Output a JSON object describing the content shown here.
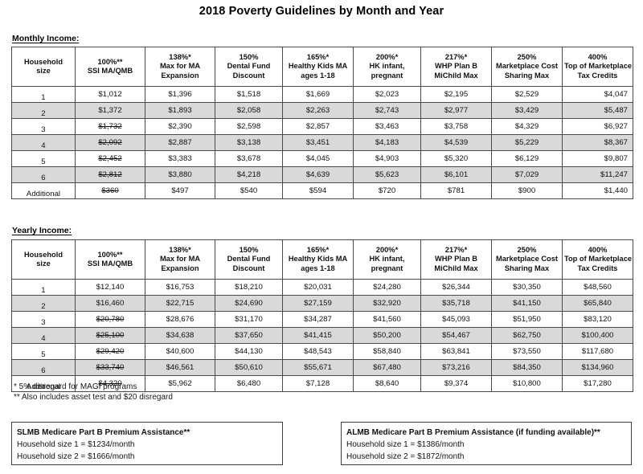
{
  "document": {
    "title": "2018 Poverty Guidelines by Month and Year"
  },
  "sections": {
    "monthly_label": "Monthly Income:",
    "yearly_label": "Yearly Income:"
  },
  "table_headers": [
    {
      "line1": "Household",
      "line2": "size",
      "line3": ""
    },
    {
      "line1": "100%**",
      "line2": "SSI MA/QMB",
      "line3": ""
    },
    {
      "line1": "138%*",
      "line2": "Max for MA",
      "line3": "Expansion"
    },
    {
      "line1": "150%",
      "line2": "Dental Fund",
      "line3": "Discount"
    },
    {
      "line1": "165%*",
      "line2": "Healthy Kids MA",
      "line3": "ages 1-18"
    },
    {
      "line1": "200%*",
      "line2": "HK infant,",
      "line3": "pregnant"
    },
    {
      "line1": "217%*",
      "line2": "WHP Plan B",
      "line3": "MiChild Max"
    },
    {
      "line1": "250%",
      "line2": "Marketplace Cost",
      "line3": "Sharing Max"
    },
    {
      "line1": "400%",
      "line2": "Top of Marketplace",
      "line3": "Tax Credits"
    }
  ],
  "monthly_rows": [
    {
      "size": "1",
      "shaded": false,
      "values": [
        "$1,012",
        "$1,396",
        "$1,518",
        "$1,669",
        "$2,023",
        "$2,195",
        "$2,529",
        "$4,047"
      ],
      "struck": [
        false,
        false,
        false,
        false,
        false,
        false,
        false,
        false
      ]
    },
    {
      "size": "2",
      "shaded": true,
      "values": [
        "$1,372",
        "$1,893",
        "$2,058",
        "$2,263",
        "$2,743",
        "$2,977",
        "$3,429",
        "$5,487"
      ],
      "struck": [
        false,
        false,
        false,
        false,
        false,
        false,
        false,
        false
      ]
    },
    {
      "size": "3",
      "shaded": false,
      "values": [
        "$1,732",
        "$2,390",
        "$2,598",
        "$2,857",
        "$3,463",
        "$3,758",
        "$4,329",
        "$6,927"
      ],
      "struck": [
        true,
        false,
        false,
        false,
        false,
        false,
        false,
        false
      ]
    },
    {
      "size": "4",
      "shaded": true,
      "values": [
        "$2,092",
        "$2,887",
        "$3,138",
        "$3,451",
        "$4,183",
        "$4,539",
        "$5,229",
        "$8,367"
      ],
      "struck": [
        true,
        false,
        false,
        false,
        false,
        false,
        false,
        false
      ]
    },
    {
      "size": "5",
      "shaded": false,
      "values": [
        "$2,452",
        "$3,383",
        "$3,678",
        "$4,045",
        "$4,903",
        "$5,320",
        "$6,129",
        "$9,807"
      ],
      "struck": [
        true,
        false,
        false,
        false,
        false,
        false,
        false,
        false
      ]
    },
    {
      "size": "6",
      "shaded": true,
      "values": [
        "$2,812",
        "$3,880",
        "$4,218",
        "$4,639",
        "$5,623",
        "$6,101",
        "$7,029",
        "$11,247"
      ],
      "struck": [
        true,
        false,
        false,
        false,
        false,
        false,
        false,
        false
      ]
    },
    {
      "size": "Additional",
      "shaded": false,
      "values": [
        "$360",
        "$497",
        "$540",
        "$594",
        "$720",
        "$781",
        "$900",
        "$1,440"
      ],
      "struck": [
        true,
        false,
        false,
        false,
        false,
        false,
        false,
        false
      ]
    }
  ],
  "yearly_rows": [
    {
      "size": "1",
      "shaded": false,
      "values": [
        "$12,140",
        "$16,753",
        "$18,210",
        "$20,031",
        "$24,280",
        "$26,344",
        "$30,350",
        "$48,560"
      ],
      "struck": [
        false,
        false,
        false,
        false,
        false,
        false,
        false,
        false
      ]
    },
    {
      "size": "2",
      "shaded": true,
      "values": [
        "$16,460",
        "$22,715",
        "$24,690",
        "$27,159",
        "$32,920",
        "$35,718",
        "$41,150",
        "$65,840"
      ],
      "struck": [
        false,
        false,
        false,
        false,
        false,
        false,
        false,
        false
      ]
    },
    {
      "size": "3",
      "shaded": false,
      "values": [
        "$20,780",
        "$28,676",
        "$31,170",
        "$34,287",
        "$41,560",
        "$45,093",
        "$51,950",
        "$83,120"
      ],
      "struck": [
        true,
        false,
        false,
        false,
        false,
        false,
        false,
        false
      ]
    },
    {
      "size": "4",
      "shaded": true,
      "values": [
        "$25,100",
        "$34,638",
        "$37,650",
        "$41,415",
        "$50,200",
        "$54,467",
        "$62,750",
        "$100,400"
      ],
      "struck": [
        true,
        false,
        false,
        false,
        false,
        false,
        false,
        false
      ]
    },
    {
      "size": "5",
      "shaded": false,
      "values": [
        "$29,420",
        "$40,600",
        "$44,130",
        "$48,543",
        "$58,840",
        "$63,841",
        "$73,550",
        "$117,680"
      ],
      "struck": [
        true,
        false,
        false,
        false,
        false,
        false,
        false,
        false
      ]
    },
    {
      "size": "6",
      "shaded": true,
      "values": [
        "$33,740",
        "$46,561",
        "$50,610",
        "$55,671",
        "$67,480",
        "$73,216",
        "$84,350",
        "$134,960"
      ],
      "struck": [
        true,
        false,
        false,
        false,
        false,
        false,
        false,
        false
      ]
    },
    {
      "size": "Additional",
      "shaded": false,
      "values": [
        "$4,320",
        "$5,962",
        "$6,480",
        "$7,128",
        "$8,640",
        "$9,374",
        "$10,800",
        "$17,280"
      ],
      "struck": [
        true,
        false,
        false,
        false,
        false,
        false,
        false,
        false
      ]
    }
  ],
  "footnotes": {
    "one": "* 5% disregard for MAGI programs",
    "two": "** Also includes asset test and $20 disregard"
  },
  "info_boxes": [
    {
      "title": "SLMB Medicare Part B Premium Assistance**",
      "line1": "Household size 1 = $1234/month",
      "line2": "Household size 2 = $1666/month"
    },
    {
      "title": "ALMB Medicare Part B Premium Assistance (if funding available)**",
      "line1": "Household size 1 = $1386/month",
      "line2": "Household size 2 = $1872/month"
    }
  ],
  "colors": {
    "shade_row": "#d9d9d9",
    "border": "#4a4a4a",
    "text": "#111111"
  }
}
